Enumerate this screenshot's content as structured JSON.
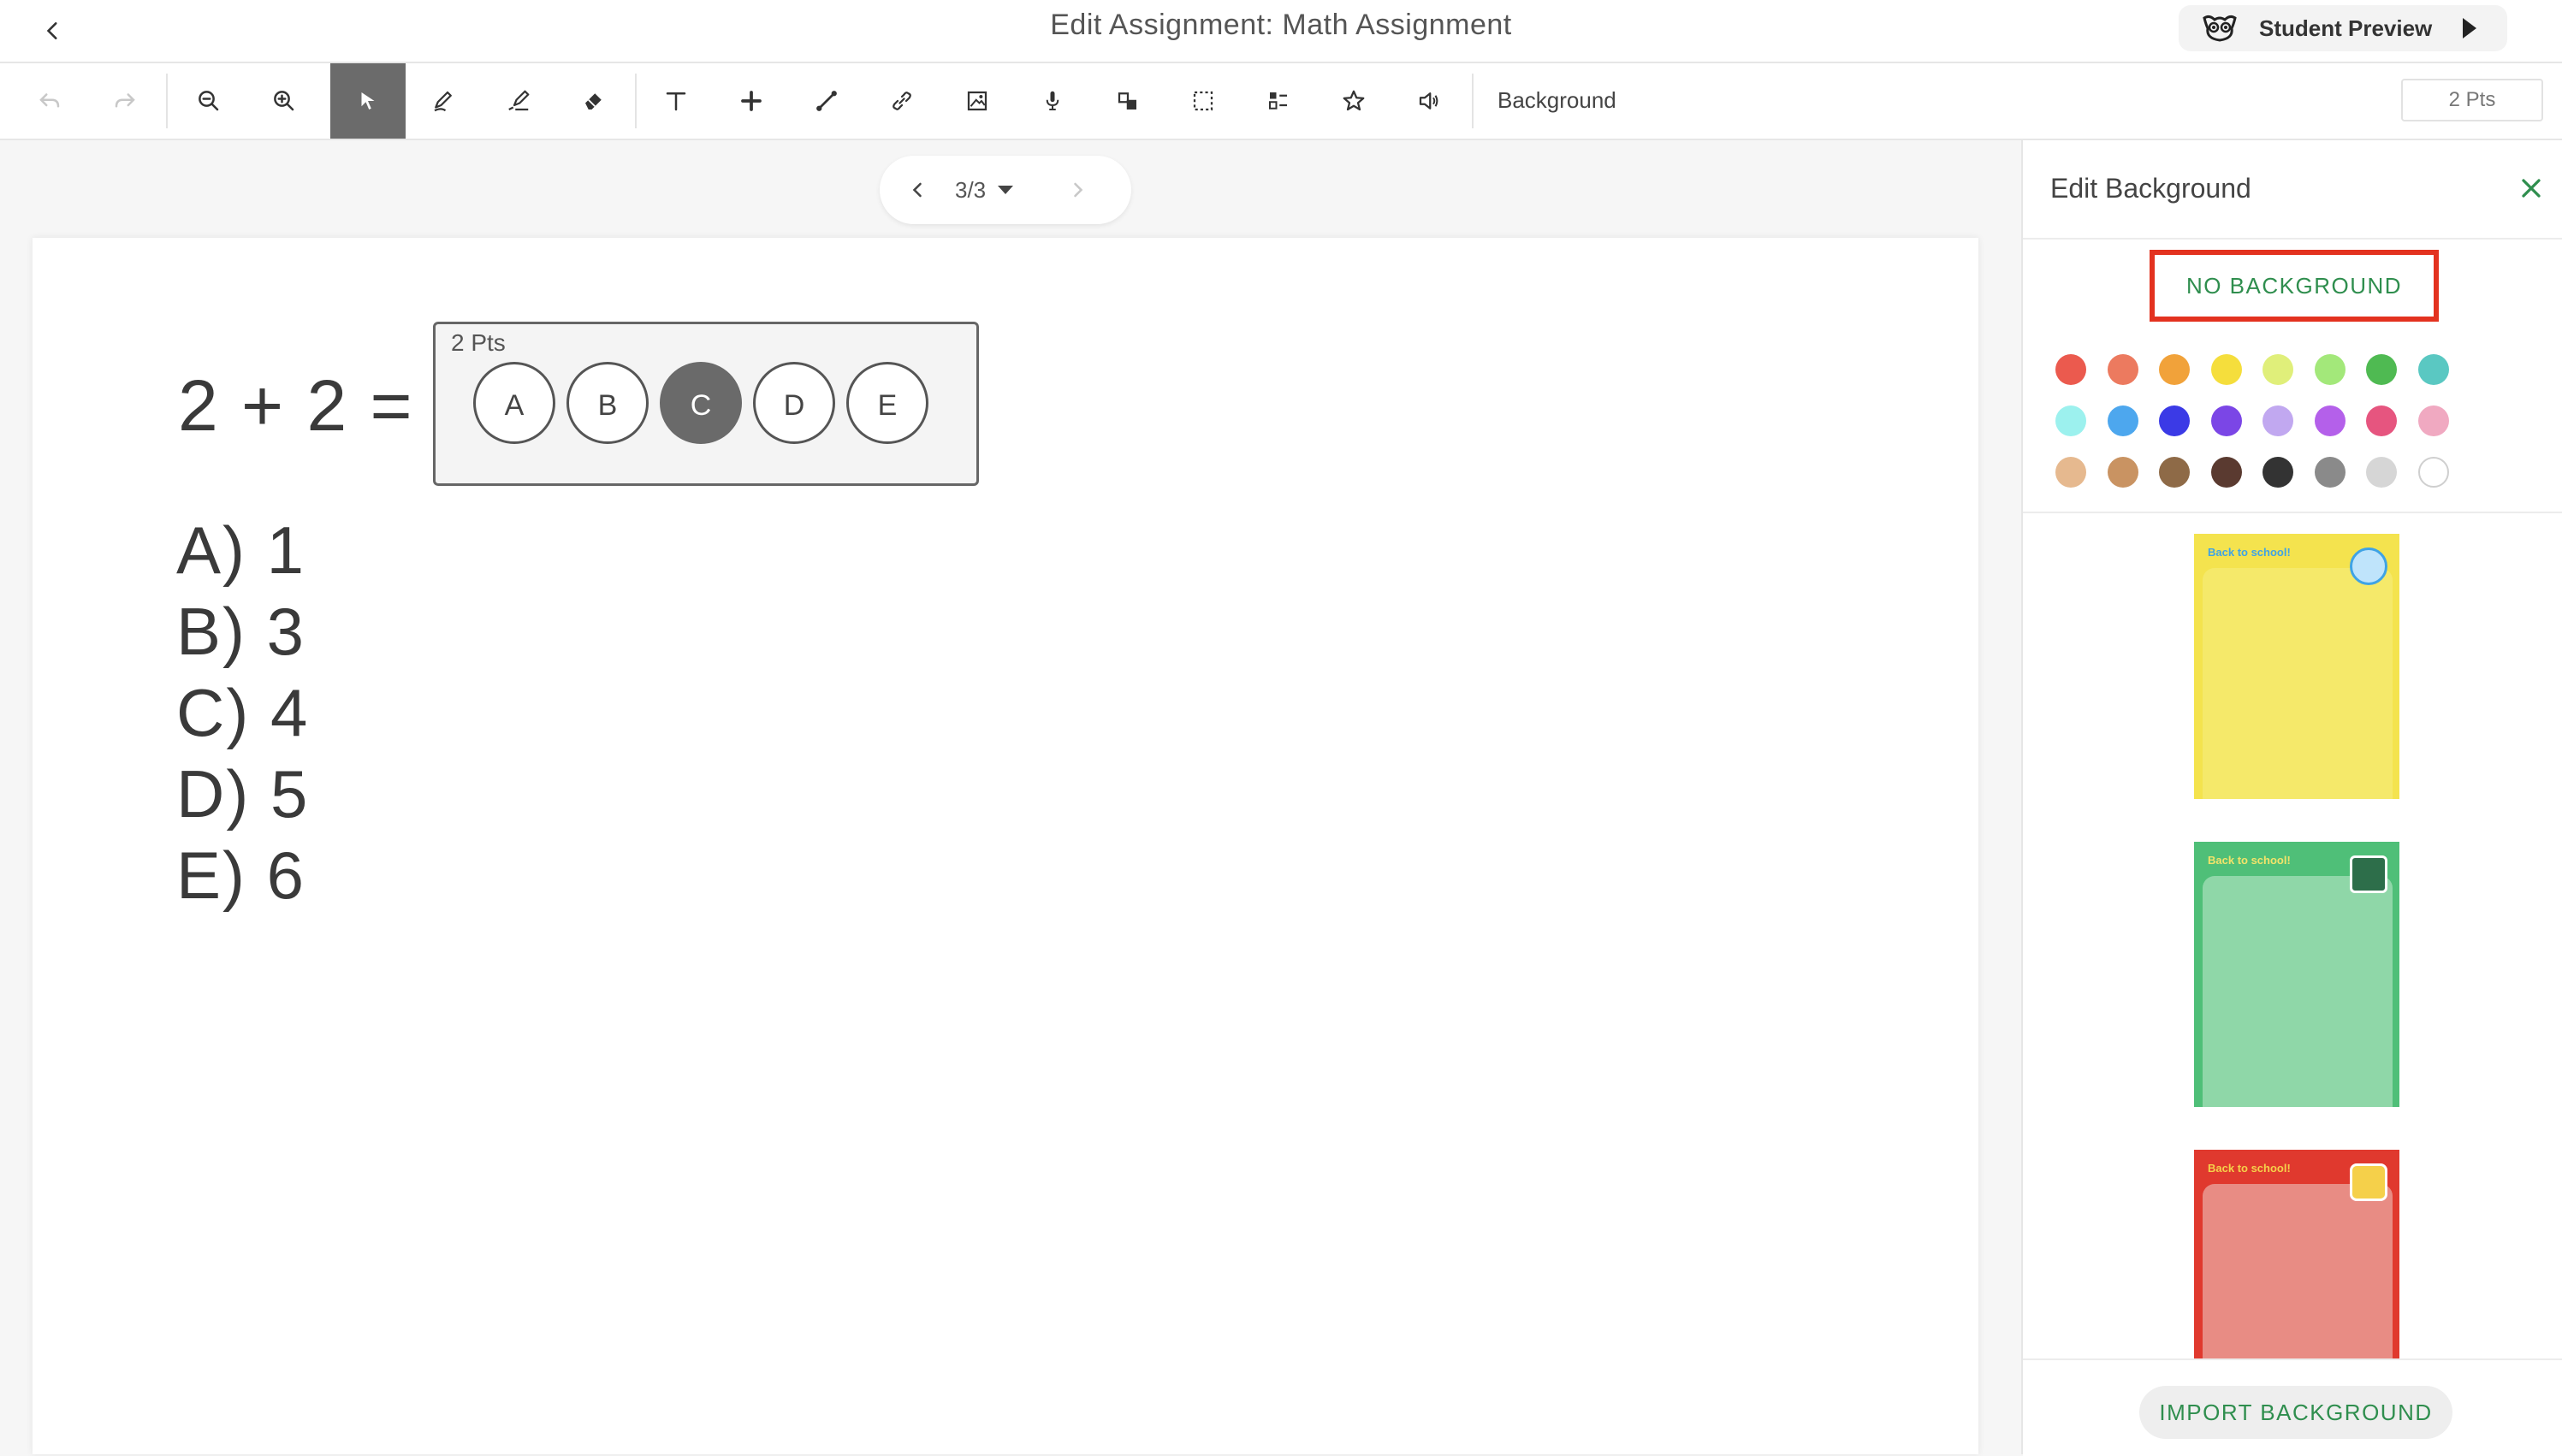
{
  "header": {
    "title": "Edit Assignment: Math Assignment",
    "student_preview_label": "Student Preview"
  },
  "toolbar": {
    "tools": [
      {
        "name": "undo-button",
        "icon": "undo-icon"
      },
      {
        "name": "redo-button",
        "icon": "redo-icon"
      },
      {
        "name": "zoom-out-button",
        "icon": "zoom-out-icon"
      },
      {
        "name": "zoom-in-button",
        "icon": "zoom-in-icon"
      },
      {
        "name": "select-tool-button",
        "icon": "cursor-icon",
        "active": true
      },
      {
        "name": "pen-tool-button",
        "icon": "pen-icon"
      },
      {
        "name": "highlighter-tool-button",
        "icon": "highlighter-icon"
      },
      {
        "name": "eraser-tool-button",
        "icon": "eraser-icon"
      },
      {
        "name": "text-tool-button",
        "icon": "text-icon"
      },
      {
        "name": "add-tool-button",
        "icon": "plus-icon"
      },
      {
        "name": "line-tool-button",
        "icon": "line-icon"
      },
      {
        "name": "link-tool-button",
        "icon": "link-icon"
      },
      {
        "name": "image-tool-button",
        "icon": "image-icon"
      },
      {
        "name": "audio-tool-button",
        "icon": "microphone-icon"
      },
      {
        "name": "shapes-tool-button",
        "icon": "shapes-icon"
      },
      {
        "name": "area-select-tool-button",
        "icon": "dashed-square-icon"
      },
      {
        "name": "multiple-choice-tool-button",
        "icon": "list-choice-icon"
      },
      {
        "name": "sticker-tool-button",
        "icon": "star-icon"
      },
      {
        "name": "speaker-tool-button",
        "icon": "speaker-icon"
      }
    ],
    "background_label": "Background",
    "points_value": "2 Pts"
  },
  "pager": {
    "current": "3/3"
  },
  "page": {
    "equation": "2 + 2 =",
    "answer_box": {
      "points_label": "2 Pts",
      "options": [
        "A",
        "B",
        "C",
        "D",
        "E"
      ],
      "selected": "C"
    },
    "answers": [
      "A) 1",
      "B) 3",
      "C) 4",
      "D) 5",
      "E) 6"
    ]
  },
  "panel": {
    "title": "Edit Background",
    "no_background_label": "NO BACKGROUND",
    "swatch_colors": [
      [
        "#eb5a4e",
        "#ec7a5f",
        "#f1a23a",
        "#f5de3c",
        "#e0ef7a",
        "#a3e87a",
        "#4fba52",
        "#5ac8c2"
      ],
      [
        "#9cf1ee",
        "#4da7ee",
        "#3b3ae6",
        "#7b46e6",
        "#c1a8f0",
        "#b460ea",
        "#e6557f",
        "#f0a9c1"
      ],
      [
        "#e6b98f",
        "#c99362",
        "#8e6a47",
        "#5a3a30",
        "#333333",
        "#8a8a8a",
        "#d6d6d6",
        "#ffffff"
      ]
    ],
    "background_templates": [
      {
        "name": "yellow",
        "caption": "Back to school!",
        "color": "#f4e34e",
        "accent": "#3fa3e5"
      },
      {
        "name": "green",
        "caption": "Back to school!",
        "color": "#8fd7a8",
        "accent": "#f2e36a"
      },
      {
        "name": "red",
        "caption": "Back to school!",
        "color": "#e88c84",
        "accent": "#f5d04a"
      }
    ],
    "import_label": "IMPORT BACKGROUND"
  },
  "colors": {
    "accent_green": "#2f8e4e",
    "highlight_red": "#e3321f",
    "active_tool": "#6b6b6b"
  }
}
